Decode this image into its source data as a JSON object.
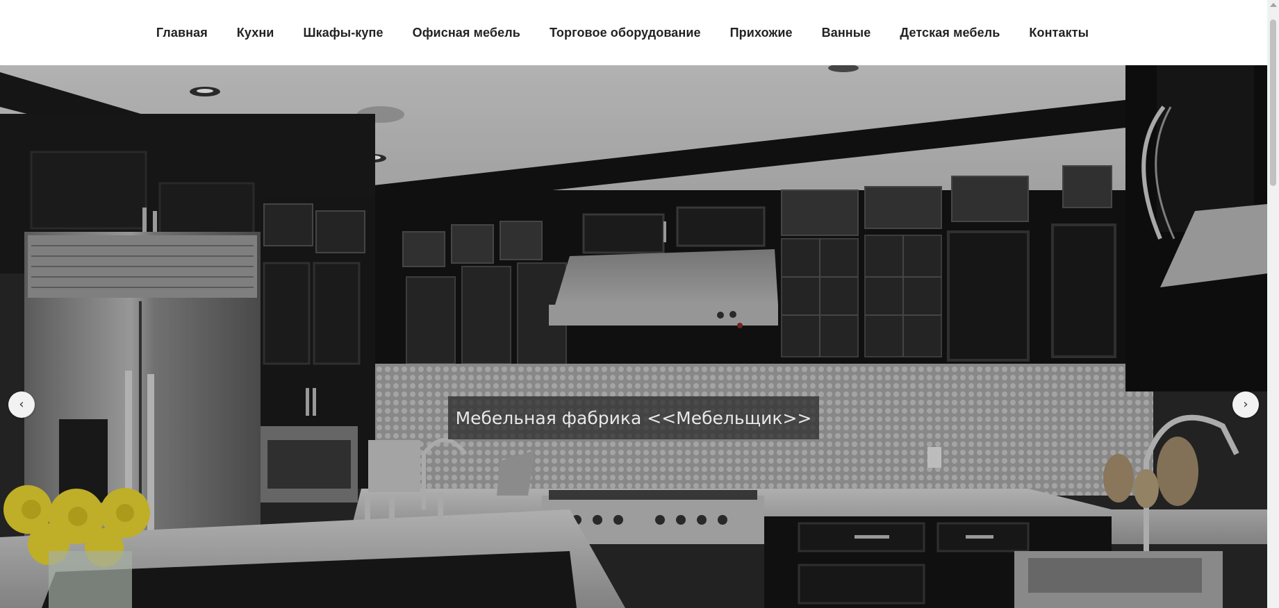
{
  "nav": {
    "items": [
      {
        "label": "Главная"
      },
      {
        "label": "Кухни"
      },
      {
        "label": "Шкафы-купе"
      },
      {
        "label": "Офисная мебель"
      },
      {
        "label": "Торговое оборудование"
      },
      {
        "label": "Прихожие"
      },
      {
        "label": "Ванные"
      },
      {
        "label": "Детская мебель"
      },
      {
        "label": "Контакты"
      }
    ]
  },
  "hero": {
    "caption": "Мебельная фабрика <<Мебельщик>>",
    "prev_icon": "‹",
    "next_icon": "›"
  },
  "colors": {
    "nav_text": "#222222",
    "caption_bg": "#282828",
    "caption_text": "#e8e8e8"
  }
}
